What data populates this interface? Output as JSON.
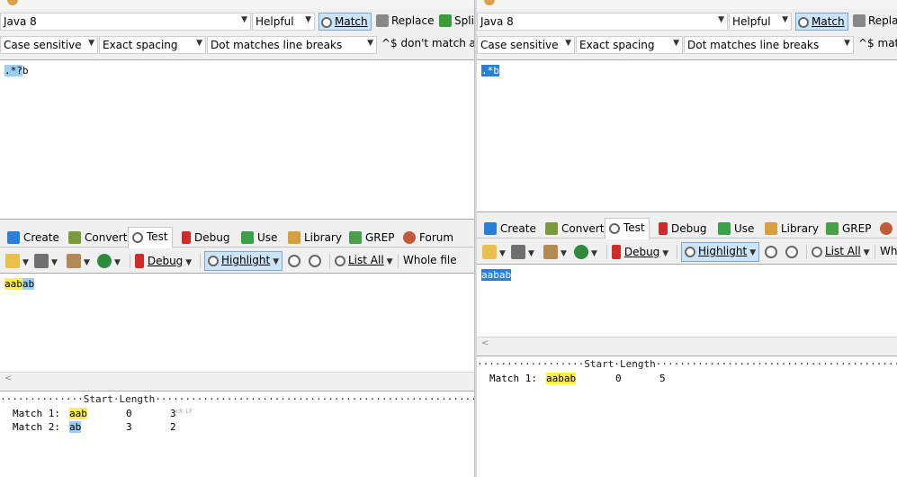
{
  "left": {
    "toolbar1": {
      "flavor": "Java 8",
      "mode": "Helpful",
      "match_label": "Match",
      "replace_label": "Replace",
      "split_label": "Split"
    },
    "options": {
      "case": "Case sensitive",
      "spacing": "Exact spacing",
      "dot": "Dot matches line breaks",
      "anchors": "^$ don't match at"
    },
    "regex": {
      "selected": ".*?",
      "rest": "b"
    },
    "tabs": [
      "Create",
      "Convert",
      "Test",
      "Debug",
      "Use",
      "Library",
      "GREP",
      "Forum"
    ],
    "toolbar2": {
      "debug_label": "Debug",
      "highlight_label": "Highlight",
      "listall_label": "List All",
      "scope": "Whole file"
    },
    "subject": {
      "part1": "aab",
      "part2": "ab"
    },
    "results": {
      "header_prefix": "··············",
      "header_start": "Start",
      "header_length": "Length",
      "header_suffix": "·································································",
      "rows": [
        {
          "label": "Match 1:",
          "text": "aab",
          "start": "0",
          "length": "3",
          "extra": "CR LF"
        },
        {
          "label": "Match 2:",
          "text": "ab",
          "start": "3",
          "length": "2",
          "extra": ""
        }
      ]
    }
  },
  "right": {
    "toolbar1": {
      "flavor": "Java 8",
      "mode": "Helpful",
      "match_label": "Match",
      "replace_label": "Repla"
    },
    "options": {
      "case": "Case sensitive",
      "spacing": "Exact spacing",
      "dot": "Dot matches line breaks",
      "anchors": "^$ matc"
    },
    "regex": {
      "selected": ".*b"
    },
    "tabs": [
      "Create",
      "Convert",
      "Test",
      "Debug",
      "Use",
      "Library",
      "GREP"
    ],
    "toolbar2": {
      "debug_label": "Debug",
      "highlight_label": "Highlight",
      "listall_label": "List All",
      "scope": "Wh"
    },
    "subject": {
      "text": "aabab"
    },
    "results": {
      "header_prefix": "··················",
      "header_start": "Start",
      "header_length": "Length",
      "header_suffix": "························································",
      "rows": [
        {
          "label": "Match 1:",
          "text": "aabab",
          "start": "0",
          "length": "5"
        }
      ]
    }
  }
}
